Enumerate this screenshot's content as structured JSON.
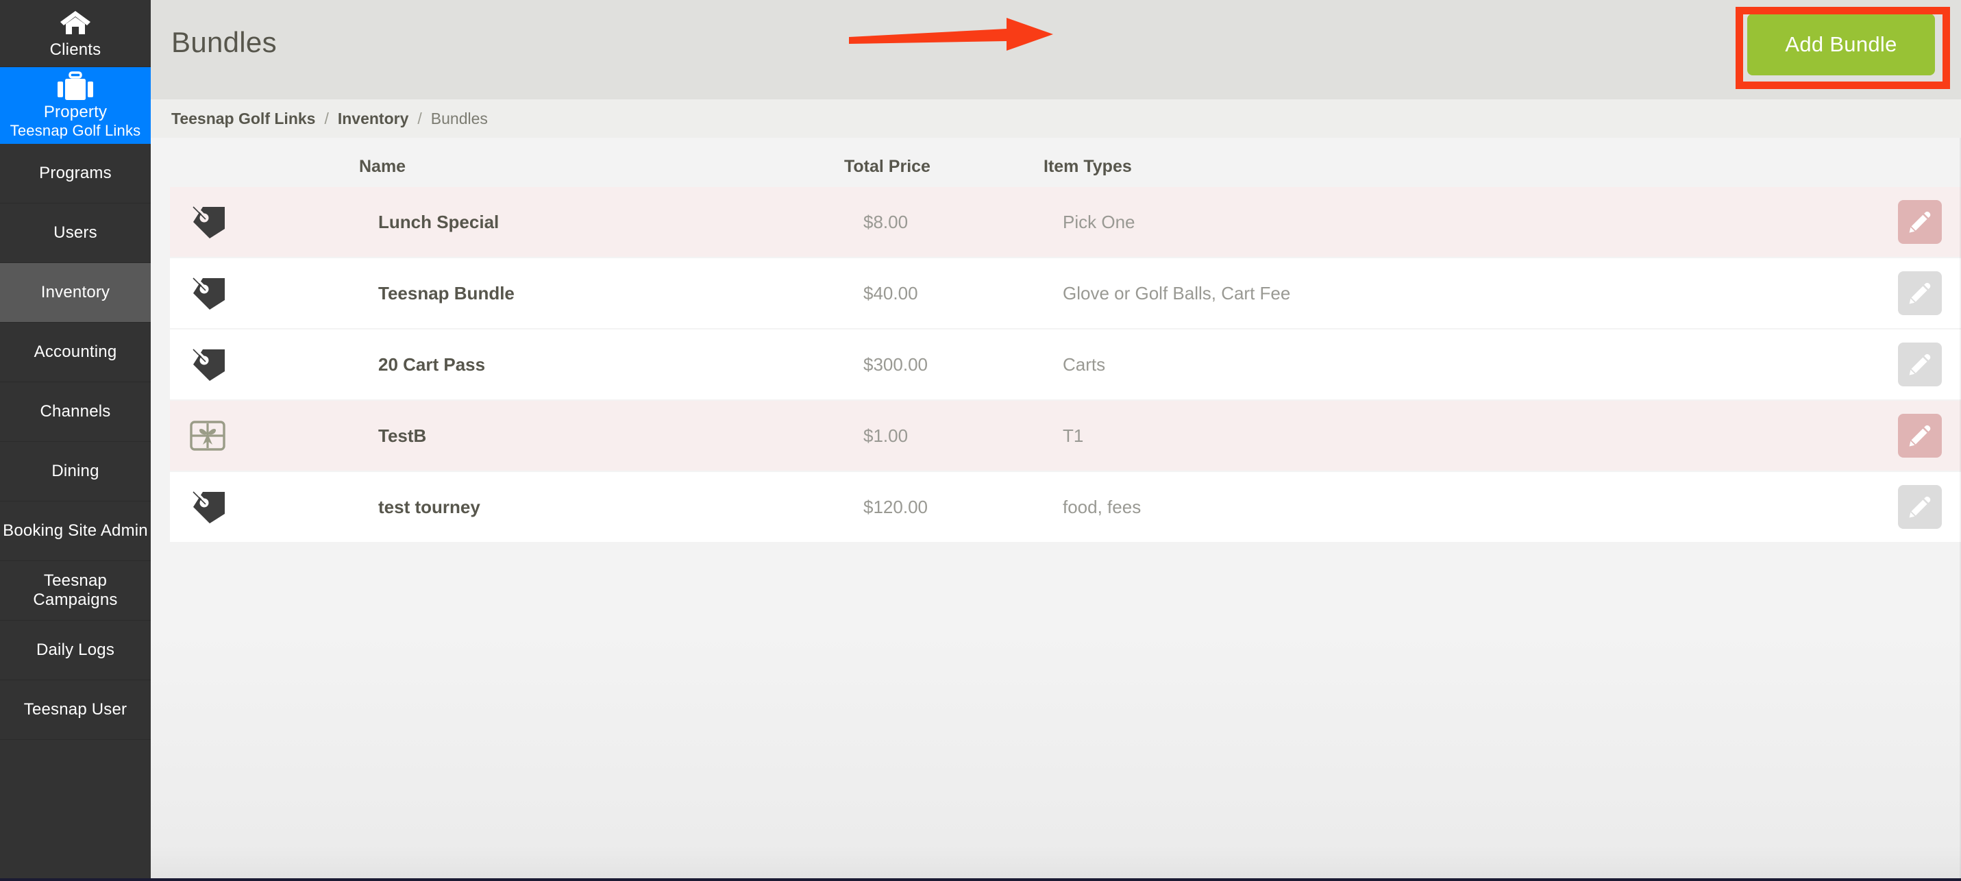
{
  "sidebar": {
    "items": [
      {
        "label": "Clients",
        "icon": "home-icon",
        "state": "home",
        "name": "clients"
      },
      {
        "label": "Property",
        "sublabel": "Teesnap Golf Links",
        "icon": "briefcase-icon",
        "state": "property",
        "name": "property"
      },
      {
        "label": "Programs",
        "state": "plain",
        "name": "programs"
      },
      {
        "label": "Users",
        "state": "plain",
        "name": "users"
      },
      {
        "label": "Inventory",
        "state": "active",
        "name": "inventory"
      },
      {
        "label": "Accounting",
        "state": "plain",
        "name": "accounting"
      },
      {
        "label": "Channels",
        "state": "plain",
        "name": "channels"
      },
      {
        "label": "Dining",
        "state": "plain",
        "name": "dining"
      },
      {
        "label": "Booking Site Admin",
        "state": "tall",
        "name": "booking-site-admin"
      },
      {
        "label": "Teesnap Campaigns",
        "state": "tall",
        "name": "teesnap-campaigns"
      },
      {
        "label": "Daily Logs",
        "state": "plain",
        "name": "daily-logs"
      },
      {
        "label": "Teesnap User",
        "state": "plain",
        "name": "teesnap-user"
      }
    ]
  },
  "header": {
    "title": "Bundles",
    "add_button_label": "Add Bundle"
  },
  "breadcrumb": {
    "items": [
      {
        "label": "Teesnap Golf Links",
        "current": false
      },
      {
        "label": "Inventory",
        "current": false
      },
      {
        "label": "Bundles",
        "current": true
      }
    ],
    "separator": "/"
  },
  "table": {
    "columns": [
      "Name",
      "Total Price",
      "Item Types"
    ],
    "rows": [
      {
        "icon": "price-tag-icon",
        "name": "Lunch Special",
        "total_price": "$8.00",
        "item_types": "Pick One",
        "highlighted": true,
        "edit_label": "edit-icon"
      },
      {
        "icon": "price-tag-icon",
        "name": "Teesnap Bundle",
        "total_price": "$40.00",
        "item_types": "Glove or Golf Balls, Cart Fee",
        "highlighted": false,
        "edit_label": "edit-icon"
      },
      {
        "icon": "price-tag-icon",
        "name": "20 Cart Pass",
        "total_price": "$300.00",
        "item_types": "Carts",
        "highlighted": false,
        "edit_label": "edit-icon"
      },
      {
        "icon": "gift-box-icon",
        "name": "TestB",
        "total_price": "$1.00",
        "item_types": "T1",
        "highlighted": true,
        "edit_label": "edit-icon"
      },
      {
        "icon": "price-tag-icon",
        "name": "test tourney",
        "total_price": "$120.00",
        "item_types": "food, fees",
        "highlighted": false,
        "edit_label": "edit-icon"
      }
    ]
  },
  "annotation": {
    "highlight_color": "#f93c16",
    "arrow_color": "#f93c16",
    "target": "Add Bundle"
  },
  "colors": {
    "sidebar_bg": "#333333",
    "sidebar_active": "#595959",
    "property_blue": "#0080ff",
    "add_button_green": "#98c235",
    "topbar_bg": "#e0e0dd",
    "breadcrumb_bg": "#eeeeec",
    "row_highlight": "#f8eeee",
    "edit_btn_gray": "#dcdcdc",
    "edit_btn_pink": "#e0b4b4"
  }
}
